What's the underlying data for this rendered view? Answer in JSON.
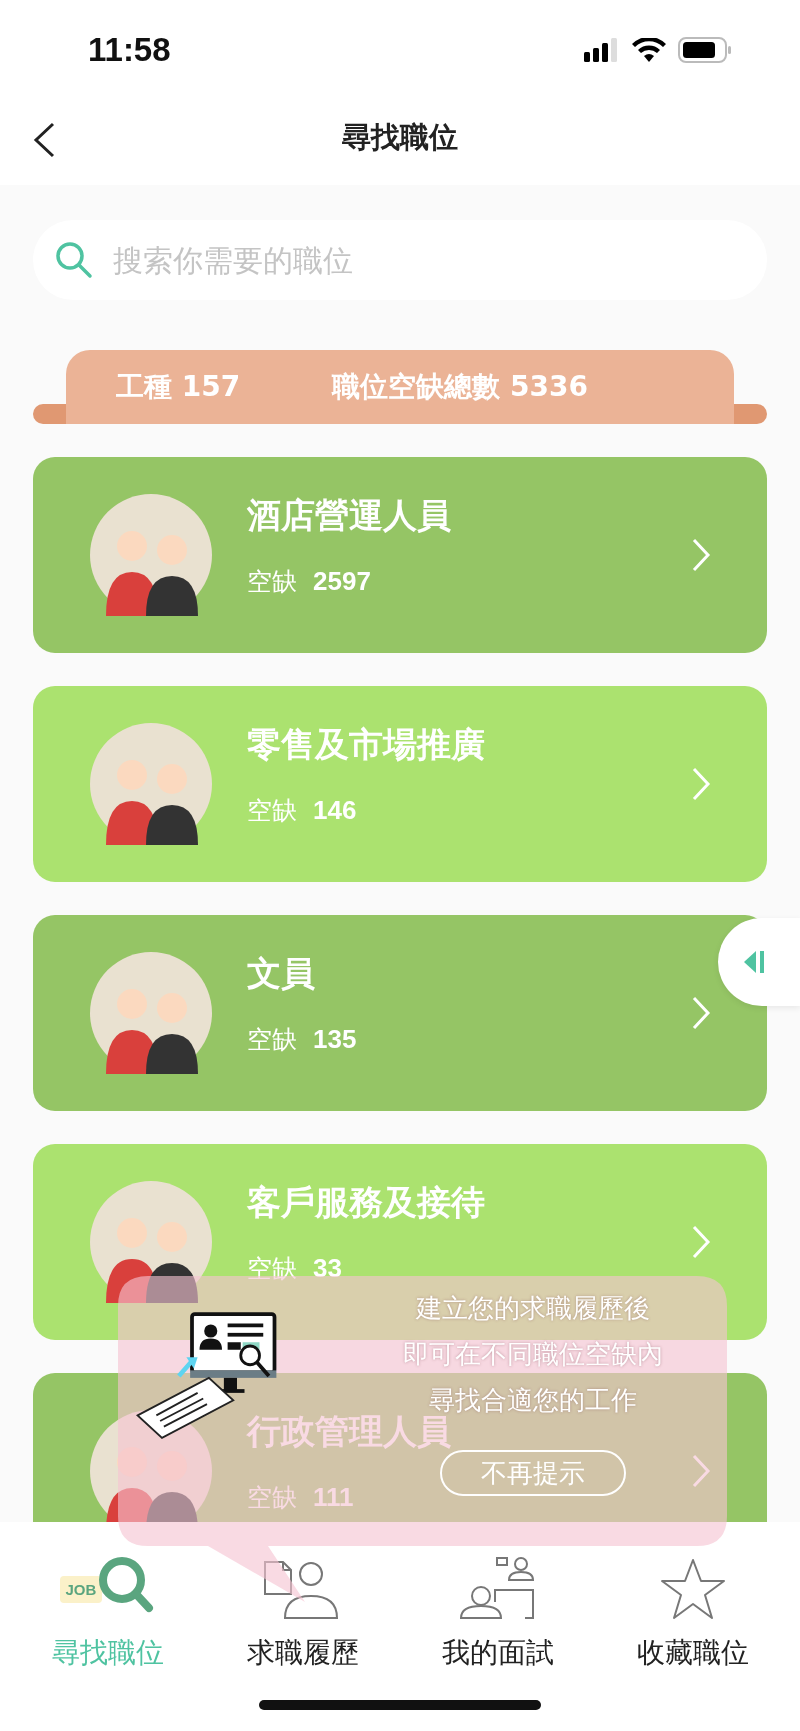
{
  "status_bar": {
    "time": "11:58"
  },
  "header": {
    "title": "尋找職位"
  },
  "search": {
    "placeholder": "搜索你需要的職位"
  },
  "stats": {
    "job_types": "工種 157",
    "total_vacancies": "職位空缺總數 5336"
  },
  "categories": [
    {
      "title": "酒店營運人員",
      "vacancy_label": "空缺",
      "count": "2597",
      "color": "#95c565"
    },
    {
      "title": "零售及市場推廣",
      "vacancy_label": "空缺",
      "count": "146",
      "color": "#abe26f"
    },
    {
      "title": "文員",
      "vacancy_label": "空缺",
      "count": "135",
      "color": "#95c565"
    },
    {
      "title": "客戶服務及接待",
      "vacancy_label": "空缺",
      "count": "33",
      "color": "#abe26f"
    },
    {
      "title": "行政管理人員",
      "vacancy_label": "空缺",
      "count": "111",
      "color": "#95c565"
    }
  ],
  "tooltip": {
    "lines": [
      "建立您的求職履歷後",
      "即可在不同職位空缺內",
      "尋找合適您的工作"
    ],
    "button": "不再提示"
  },
  "tab_bar": [
    {
      "kind": "search",
      "label": "尋找職位",
      "badge": "JOB",
      "selected": true
    },
    {
      "kind": "resume",
      "label": "求職履歷",
      "selected": false
    },
    {
      "kind": "interview",
      "label": "我的面試",
      "selected": false
    },
    {
      "kind": "favorite",
      "label": "收藏職位",
      "selected": false
    }
  ]
}
